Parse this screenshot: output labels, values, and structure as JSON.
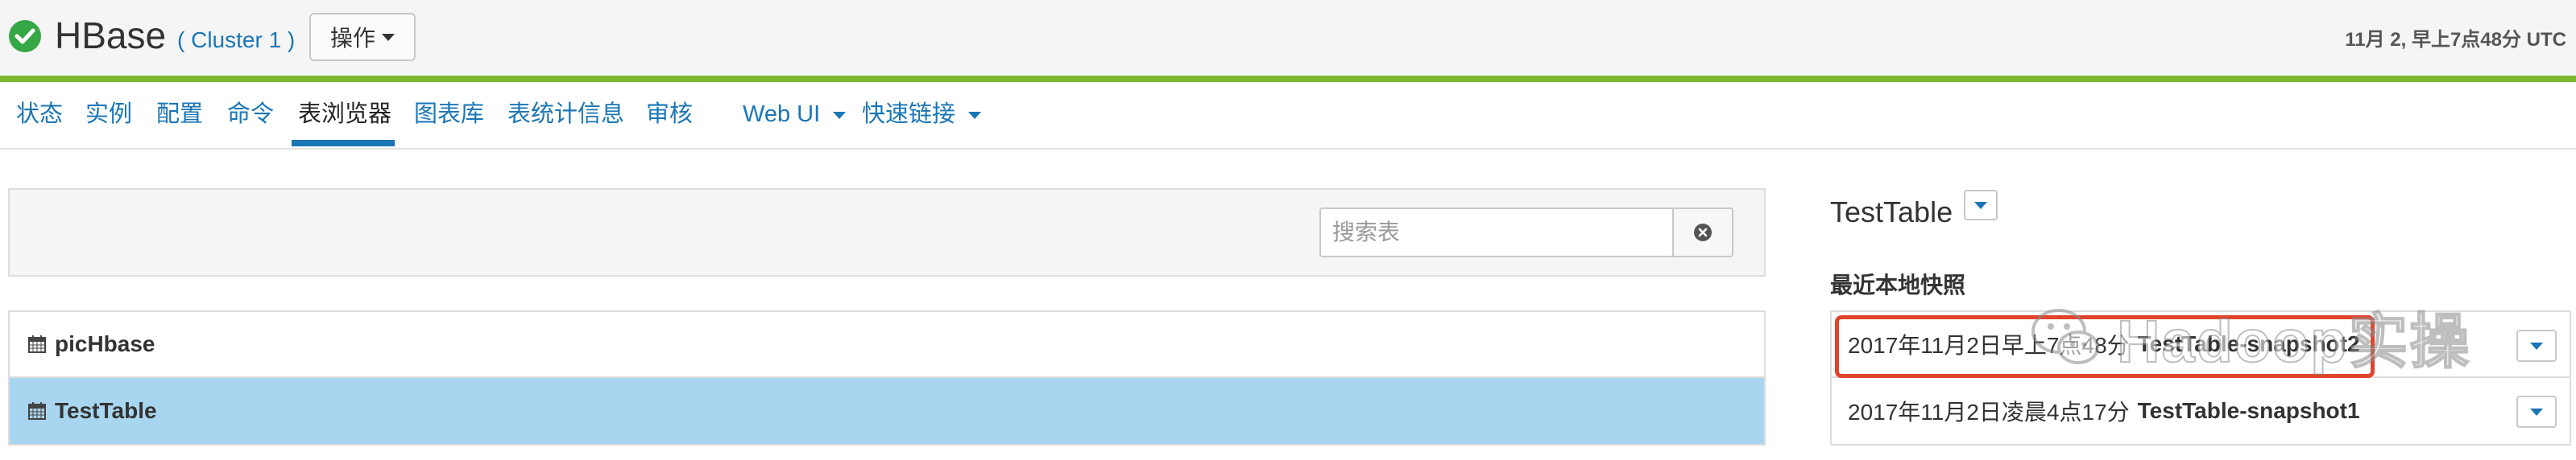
{
  "header": {
    "service_name": "HBase",
    "cluster_label": "( Cluster 1 )",
    "actions_label": "操作",
    "timestamp": "11月 2, 早上7点48分 UTC",
    "status_icon": "check-circle-icon",
    "status_color": "#35a744",
    "accent_color": "#7cb82f"
  },
  "nav": {
    "tabs": [
      {
        "label": "状态"
      },
      {
        "label": "实例"
      },
      {
        "label": "配置"
      },
      {
        "label": "命令"
      },
      {
        "label": "表浏览器",
        "active": true
      },
      {
        "label": "图表库"
      },
      {
        "label": "表统计信息"
      },
      {
        "label": "审核"
      },
      {
        "label": "Web UI",
        "dropdown": true
      },
      {
        "label": "快速链接",
        "dropdown": true
      }
    ],
    "link_color": "#1a76b6"
  },
  "search": {
    "placeholder": "搜索表",
    "clear_icon": "close-circle-icon"
  },
  "tables": [
    {
      "name": "picHbase",
      "icon": "calendar-icon",
      "selected": false
    },
    {
      "name": "TestTable",
      "icon": "calendar-icon",
      "selected": true
    }
  ],
  "detail": {
    "title": "TestTable",
    "snapshots_heading": "最近本地快照",
    "snapshots": [
      {
        "time": "2017年11月2日早上7点48分",
        "name": "TestTable-snapshot2",
        "highlighted": true
      },
      {
        "time": "2017年11月2日凌晨4点17分",
        "name": "TestTable-snapshot1",
        "highlighted": false
      }
    ],
    "selected_row_color": "#a8d6f0",
    "highlight_color": "#e0442a"
  },
  "watermark": {
    "text": "Hadoop实操",
    "icon": "wechat-icon"
  }
}
